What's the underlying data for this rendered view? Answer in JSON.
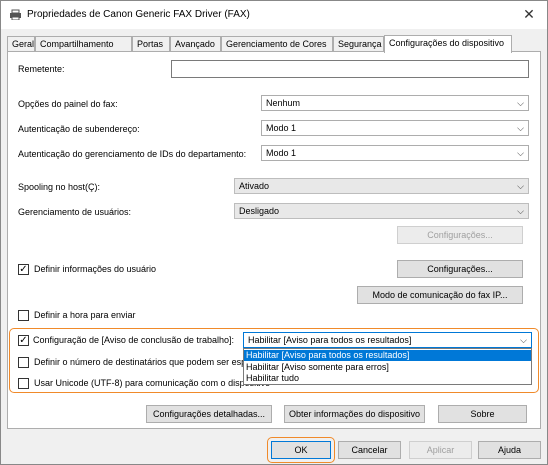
{
  "window": {
    "title": "Propriedades de Canon Generic FAX Driver (FAX)",
    "close": "✕"
  },
  "tabs": [
    "Geral",
    "Compartilhamento",
    "Portas",
    "Avançado",
    "Gerenciamento de Cores",
    "Segurança",
    "Configurações do dispositivo"
  ],
  "fields": {
    "remetente_label": "Remetente:",
    "remetente_value": "",
    "painel_label": "Opções do painel do fax:",
    "painel_value": "Nenhum",
    "subend_label": "Autenticação de subendereço:",
    "subend_value": "Modo 1",
    "gerid_label": "Autenticação do gerenciamento de IDs do departamento:",
    "gerid_value": "Modo 1",
    "spooling_label": "Spooling no host(Ç):",
    "spooling_value": "Ativado",
    "gerusu_label": "Gerenciamento de usuários:",
    "gerusu_value": "Desligado"
  },
  "buttons": {
    "configuracoes_disabled": "Configurações...",
    "configuracoes": "Configurações...",
    "modo_comunicacao": "Modo de comunicação do fax IP...",
    "config_detalhadas": "Configurações detalhadas...",
    "obter_info": "Obter informações do dispositivo",
    "sobre": "Sobre",
    "ok": "OK",
    "cancelar": "Cancelar",
    "aplicar": "Aplicar",
    "ajuda": "Ajuda"
  },
  "checks": {
    "definir_info": {
      "label": "Definir informações do usuário",
      "checked": true
    },
    "definir_hora": {
      "label": "Definir a hora para enviar",
      "checked": false
    },
    "config_aviso": {
      "label": "Configuração de [Aviso de conclusão de trabalho]:",
      "checked": true
    },
    "definir_num": {
      "label": "Definir o número de destinatários que podem ser especificados",
      "checked": false
    },
    "usar_unicode": {
      "label": "Usar Unicode (UTF-8) para comunicação com o dispositivo",
      "checked": false
    }
  },
  "aviso": {
    "value": "Habilitar [Aviso para todos os resultados]",
    "options": [
      "Habilitar [Aviso para todos os resultados]",
      "Habilitar [Aviso somente para erros]",
      "Habilitar tudo"
    ],
    "selected_index": 0
  }
}
